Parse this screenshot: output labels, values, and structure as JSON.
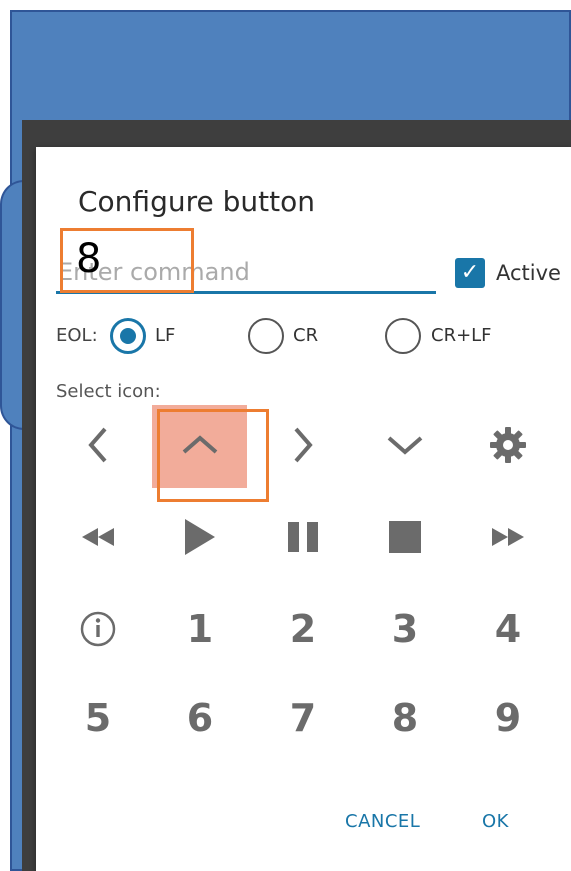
{
  "dialog": {
    "title": "Configure button",
    "command_placeholder": "Enter command",
    "active_label": "Active",
    "active_checked": true,
    "eol_label": "EOL:",
    "eol_options": [
      {
        "label": "LF",
        "checked": true
      },
      {
        "label": "CR",
        "checked": false
      },
      {
        "label": "CR+LF",
        "checked": false
      }
    ],
    "select_icon_label": "Select icon:",
    "icons_row1": [
      "chevron-left-icon",
      "chevron-up-icon",
      "chevron-right-icon",
      "chevron-down-icon",
      "gear-icon"
    ],
    "icons_row2": [
      "rewind-icon",
      "play-icon",
      "pause-icon",
      "stop-icon",
      "fast-forward-icon"
    ],
    "info_icon": "info-icon",
    "numbers_row3": [
      "1",
      "2",
      "3",
      "4"
    ],
    "numbers_row4": [
      "5",
      "6",
      "7",
      "8",
      "9"
    ],
    "cancel_label": "CANCEL",
    "ok_label": "OK"
  },
  "annotation": {
    "label": "8",
    "color": "#ed7d31"
  },
  "colors": {
    "accent": "#1976a8",
    "background_blue": "#4f81bd",
    "highlight": "#f2ac9a"
  }
}
